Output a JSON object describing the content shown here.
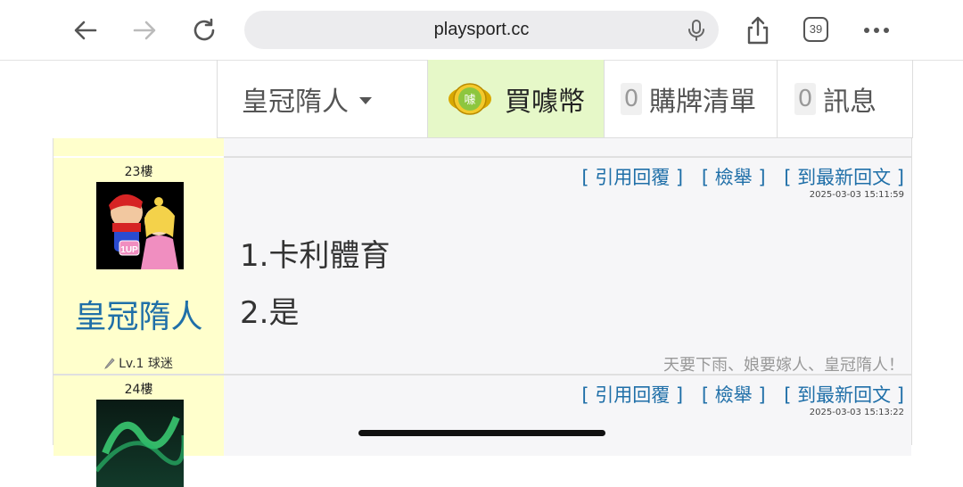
{
  "browser": {
    "url": "playsport.cc",
    "tab_count": "39"
  },
  "site_nav": {
    "user_name": "皇冠隋人",
    "buy_coin_label": "買噱幣",
    "coin_icon_text": "噱",
    "cart_count": "0",
    "cart_label": "購牌清單",
    "message_count": "0",
    "message_label": "訊息"
  },
  "posts": [
    {
      "floor": "23樓",
      "author": "皇冠隋人",
      "level": "Lv.1 球迷",
      "actions": [
        "[ 引用回覆 ]",
        "[ 檢舉 ]",
        "[ 到最新回文 ]"
      ],
      "time": "2025-03-03 15:11:59",
      "content": [
        "1.卡利體育",
        "2.是"
      ],
      "signature": "天要下雨、娘要嫁人、皇冠隋人！"
    },
    {
      "floor": "24樓",
      "actions": [
        "[ 引用回覆 ]",
        "[ 檢舉 ]",
        "[ 到最新回文 ]"
      ],
      "time": "2025-03-03 15:13:22"
    }
  ],
  "colors": {
    "link": "#1f6fa8",
    "author_bg": "#ffffcc",
    "buy_bg": "#e6f8c8"
  }
}
